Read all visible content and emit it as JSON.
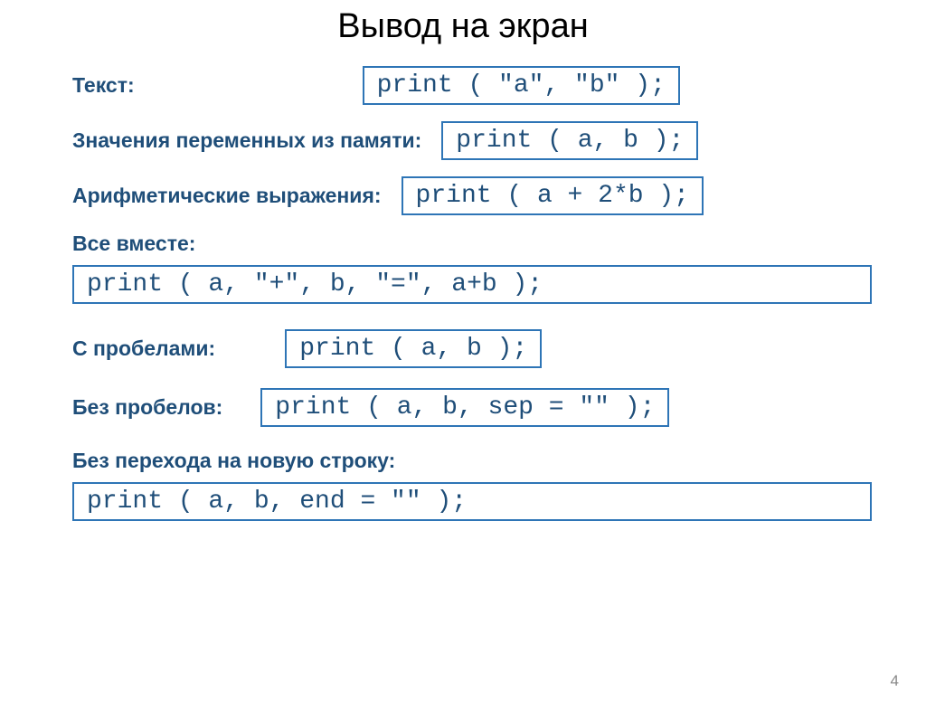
{
  "title": "Вывод на экран",
  "rows": {
    "text": {
      "label": "Текст:",
      "code": "print ( \"a\", \"b\" );"
    },
    "vars": {
      "label": "Значения переменных из памяти:",
      "code": "print ( a, b );"
    },
    "arith": {
      "label": "Арифметические выражения:",
      "code": "print ( a + 2*b );"
    },
    "together": {
      "label": "Все вместе:",
      "code": "print ( a, \"+\", b, \"=\",  a+b );"
    },
    "spaces": {
      "label": "С пробелами:",
      "code": "print ( a, b );"
    },
    "nospaces": {
      "label": "Без пробелов:",
      "code": "print ( a, b, sep = \"\" );"
    },
    "nonewline": {
      "label": "Без перехода на новую строку:",
      "code": "print ( a, b, end = \"\" );"
    }
  },
  "pageNumber": "4"
}
